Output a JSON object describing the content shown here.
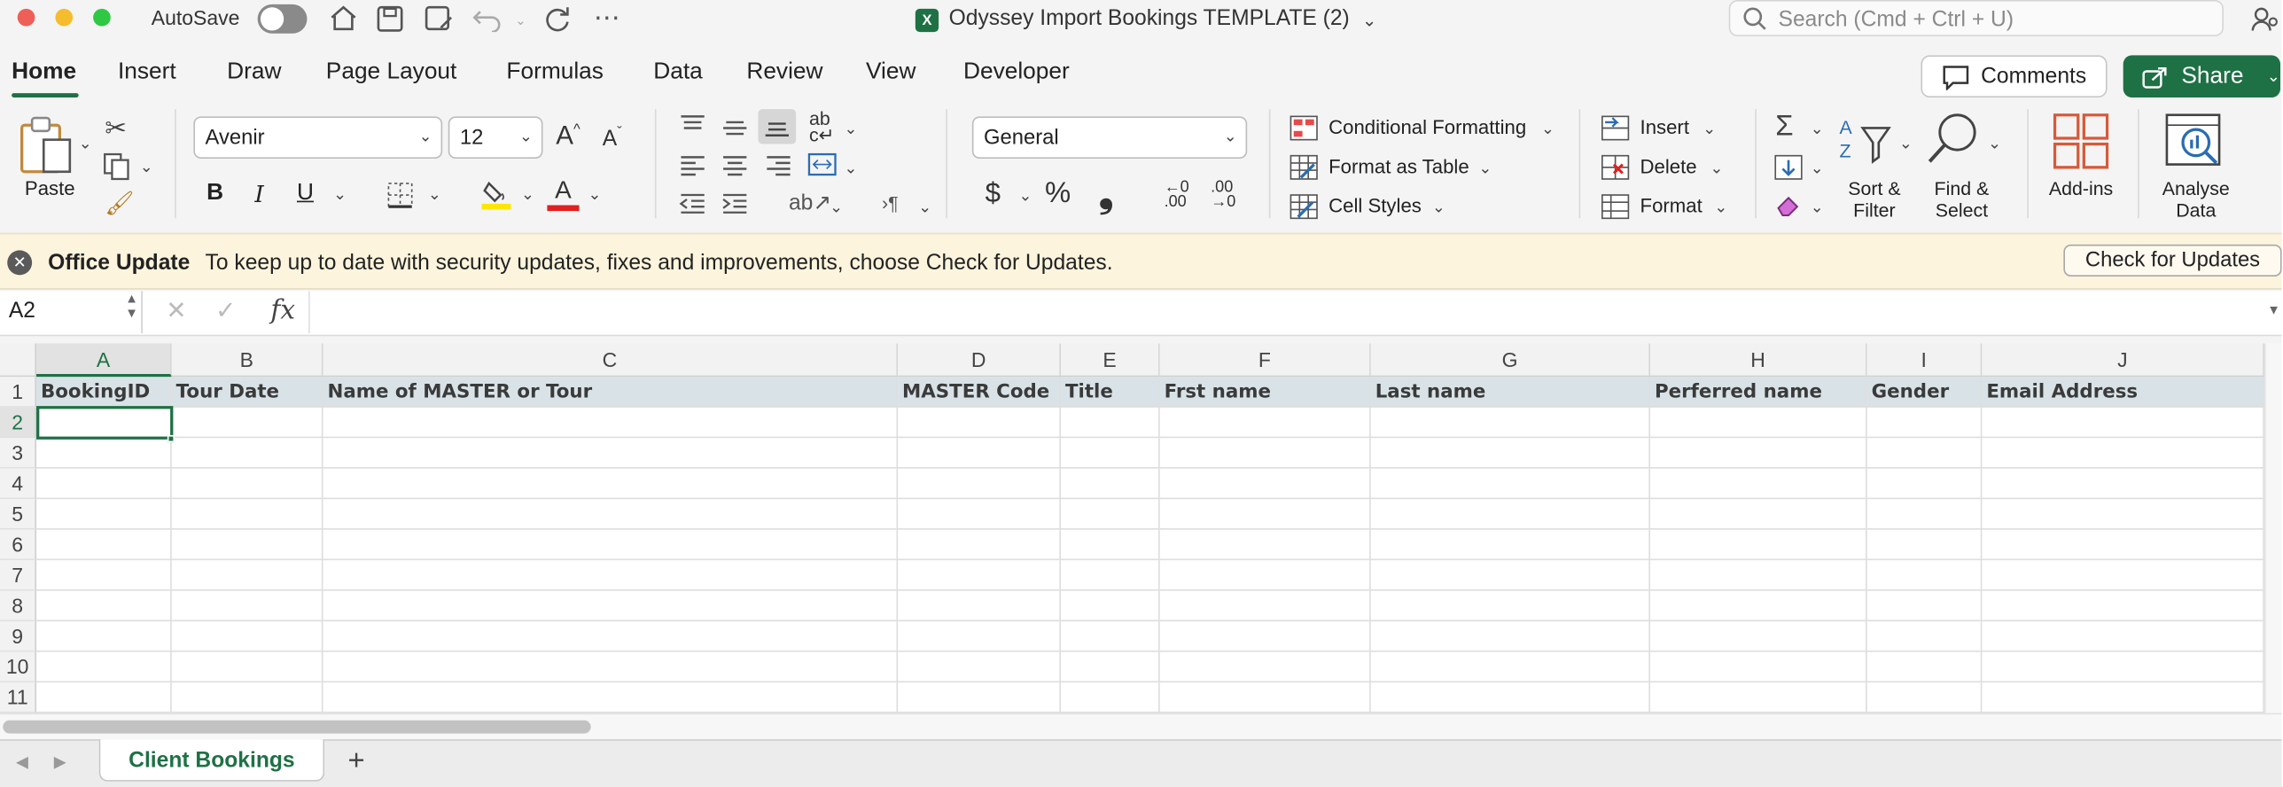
{
  "titlebar": {
    "autosave_label": "AutoSave",
    "doc_title": "Odyssey Import Bookings TEMPLATE (2)",
    "search_placeholder": "Search (Cmd + Ctrl + U)"
  },
  "tabs": [
    "Home",
    "Insert",
    "Draw",
    "Page Layout",
    "Formulas",
    "Data",
    "Review",
    "View",
    "Developer"
  ],
  "actions": {
    "comments": "Comments",
    "share": "Share"
  },
  "ribbon": {
    "paste": "Paste",
    "font_name": "Avenir",
    "font_size": "12",
    "number_format": "General",
    "conditional_formatting": "Conditional Formatting",
    "format_as_table": "Format as Table",
    "cell_styles": "Cell Styles",
    "insert": "Insert",
    "delete": "Delete",
    "format": "Format",
    "sort_filter_1": "Sort &",
    "sort_filter_2": "Filter",
    "find_select_1": "Find &",
    "find_select_2": "Select",
    "addins": "Add-ins",
    "analyse_1": "Analyse",
    "analyse_2": "Data",
    "bold": "B",
    "italic": "I",
    "underline": "U",
    "currency": "$",
    "percent": "%",
    "comma": "❟"
  },
  "update_bar": {
    "title": "Office Update",
    "message": "To keep up to date with security updates, fixes and improvements, choose Check for Updates.",
    "button": "Check for Updates"
  },
  "formula_bar": {
    "name_box": "A2",
    "fx": "fx",
    "content": ""
  },
  "grid": {
    "columns": [
      "A",
      "B",
      "C",
      "D",
      "E",
      "F",
      "G",
      "H",
      "I",
      "J"
    ],
    "rows": [
      "1",
      "2",
      "3",
      "4",
      "5",
      "6",
      "7",
      "8",
      "9",
      "10",
      "11"
    ],
    "header_row": [
      "BookingID",
      "Tour Date",
      "Name of MASTER or Tour",
      "MASTER Code",
      "Title",
      "Frst name",
      "Last name",
      "Perferred name",
      "Gender",
      "Email Address"
    ]
  },
  "sheets": {
    "active": "Client Bookings",
    "add": "+"
  },
  "colors": {
    "accent": "#1e7145",
    "header_fill": "#d9e3e7",
    "update_bg": "#fcf4dc"
  }
}
